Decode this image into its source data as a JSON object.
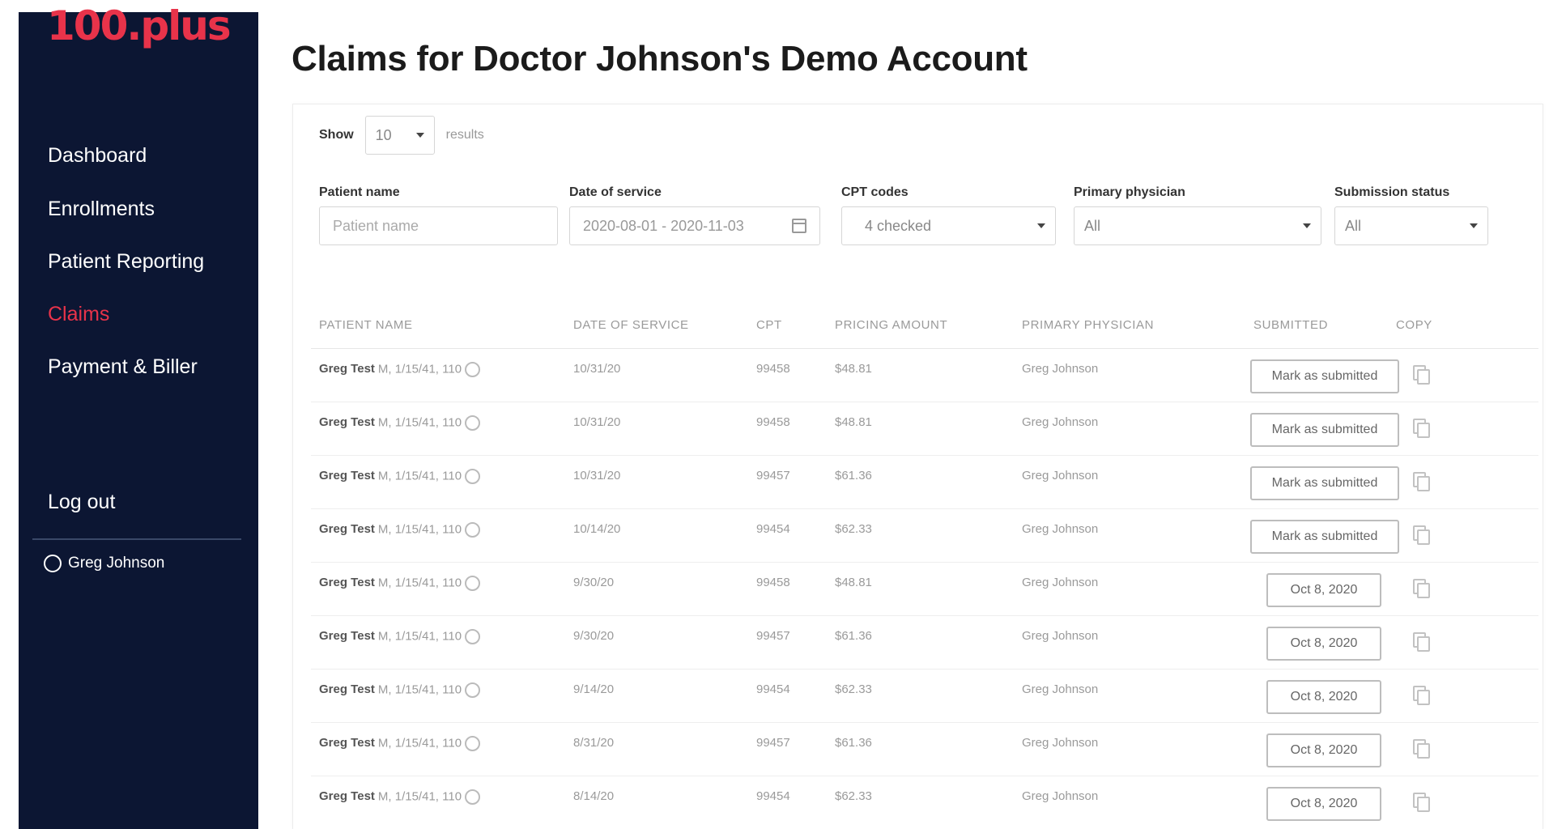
{
  "app": {
    "logo": "100.plus",
    "title": "Claims for Doctor Johnson's Demo Account"
  },
  "sidebar": {
    "items": [
      {
        "label": "Dashboard"
      },
      {
        "label": "Enrollments"
      },
      {
        "label": "Patient Reporting"
      },
      {
        "label": "Claims"
      },
      {
        "label": "Payment & Biller"
      }
    ],
    "logout": "Log out",
    "user": "Greg Johnson"
  },
  "show": {
    "label": "Show",
    "value": "10",
    "suffix": "results"
  },
  "filters": {
    "patient_name": {
      "label": "Patient name",
      "placeholder": "Patient name"
    },
    "date_of_service": {
      "label": "Date of service",
      "value": "2020-08-01 - 2020-11-03"
    },
    "cpt_codes": {
      "label": "CPT codes",
      "value": "4 checked"
    },
    "primary_physician": {
      "label": "Primary physician",
      "value": "All"
    },
    "submission_status": {
      "label": "Submission status",
      "value": "All"
    }
  },
  "table": {
    "headers": {
      "patient_name": "PATIENT NAME",
      "date_of_service": "DATE OF SERVICE",
      "cpt": "CPT",
      "pricing_amount": "PRICING AMOUNT",
      "primary_physician": "PRIMARY PHYSICIAN",
      "submitted": "SUBMITTED",
      "copy": "COPY"
    },
    "rows": [
      {
        "name": "Greg Test",
        "details": "M, 1/15/41, 110",
        "date": "10/31/20",
        "cpt": "99458",
        "amount": "$48.81",
        "physician": "Greg Johnson",
        "submitted": "Mark as submitted"
      },
      {
        "name": "Greg Test",
        "details": "M, 1/15/41, 110",
        "date": "10/31/20",
        "cpt": "99458",
        "amount": "$48.81",
        "physician": "Greg Johnson",
        "submitted": "Mark as submitted"
      },
      {
        "name": "Greg Test",
        "details": "M, 1/15/41, 110",
        "date": "10/31/20",
        "cpt": "99457",
        "amount": "$61.36",
        "physician": "Greg Johnson",
        "submitted": "Mark as submitted"
      },
      {
        "name": "Greg Test",
        "details": "M, 1/15/41, 110",
        "date": "10/14/20",
        "cpt": "99454",
        "amount": "$62.33",
        "physician": "Greg Johnson",
        "submitted": "Mark as submitted"
      },
      {
        "name": "Greg Test",
        "details": "M, 1/15/41, 110",
        "date": "9/30/20",
        "cpt": "99458",
        "amount": "$48.81",
        "physician": "Greg Johnson",
        "submitted": "Oct 8, 2020"
      },
      {
        "name": "Greg Test",
        "details": "M, 1/15/41, 110",
        "date": "9/30/20",
        "cpt": "99457",
        "amount": "$61.36",
        "physician": "Greg Johnson",
        "submitted": "Oct 8, 2020"
      },
      {
        "name": "Greg Test",
        "details": "M, 1/15/41, 110",
        "date": "9/14/20",
        "cpt": "99454",
        "amount": "$62.33",
        "physician": "Greg Johnson",
        "submitted": "Oct 8, 2020"
      },
      {
        "name": "Greg Test",
        "details": "M, 1/15/41, 110",
        "date": "8/31/20",
        "cpt": "99457",
        "amount": "$61.36",
        "physician": "Greg Johnson",
        "submitted": "Oct 8, 2020"
      },
      {
        "name": "Greg Test",
        "details": "M, 1/15/41, 110",
        "date": "8/14/20",
        "cpt": "99454",
        "amount": "$62.33",
        "physician": "Greg Johnson",
        "submitted": "Oct 8, 2020"
      }
    ]
  },
  "colors": {
    "sidebar_bg": "#0c1633",
    "brand": "#e8334a"
  }
}
